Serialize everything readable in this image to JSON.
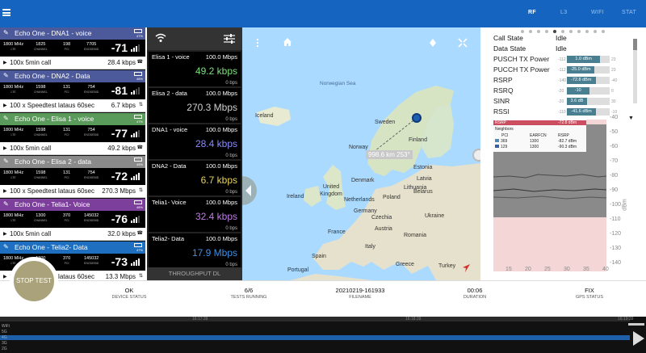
{
  "topbar": {
    "tabs": [
      {
        "label": "RF",
        "active": true
      },
      {
        "label": "L3",
        "active": false
      },
      {
        "label": "WIFI",
        "active": false
      },
      {
        "label": "STAT",
        "active": false
      }
    ]
  },
  "devices": [
    {
      "name": "Echo One - DNA1 - voice",
      "color": "#4c5a9c",
      "battery": "47%",
      "band": "1800 MHz",
      "tech": "LTE",
      "channel": "1825",
      "pci": "198",
      "enodeb": "7705",
      "signal": "-71",
      "task": "100x 5min call",
      "task_value": "28.4 kbps"
    },
    {
      "name": "Echo One - DNA2 - Data",
      "color": "#4c5a9c",
      "battery": "48%",
      "band": "1800 MHz",
      "tech": "LTE",
      "channel": "1598",
      "pci": "131",
      "enodeb": "754",
      "signal": "-81",
      "task": "100 x Speedtest lataus 60sec",
      "task_value": "6.7 kbps"
    },
    {
      "name": "Echo One - Elisa 1 - voice",
      "color": "#5a9a5a",
      "battery": "47%",
      "band": "1800 MHz",
      "tech": "LTE",
      "channel": "1598",
      "pci": "131",
      "enodeb": "754",
      "signal": "-77",
      "task": "100x 5min call",
      "task_value": "49.2 kbps"
    },
    {
      "name": "Echo One - Elisa 2 - data",
      "color": "#8a8a8a",
      "battery": "48%",
      "band": "1800 MHz",
      "tech": "LTE",
      "channel": "1598",
      "pci": "131",
      "enodeb": "754",
      "signal": "-72",
      "task": "100 x Speedtest lataus 60sec",
      "task_value": "270.3 Mbps"
    },
    {
      "name": "Echo One - Telia1- Voice",
      "color": "#7d3f9c",
      "battery": "48%",
      "band": "1800 MHz",
      "tech": "LTE",
      "channel": "1300",
      "pci": "370",
      "enodeb": "145032",
      "signal": "-76",
      "task": "100x 5min call",
      "task_value": "32.0 kbps"
    },
    {
      "name": "Echo One - Telia2- Data",
      "color": "#1f6fc0",
      "battery": "47%",
      "band": "1800 MHz",
      "tech": "LTE",
      "channel": "1300",
      "pci": "370",
      "enodeb": "145032",
      "signal": "-73",
      "task": "100 x Speedtest lataus 60sec",
      "task_value": "13.3 Mbps"
    }
  ],
  "throughput": {
    "footer": "THROUGHPUT DL",
    "rows": [
      {
        "name": "Elisa 1 - voice",
        "max": "100.0 Mbps",
        "rate": "49.2 kbps",
        "zero": "0 bps",
        "color": "#7be07b"
      },
      {
        "name": "Elisa 2 - data",
        "max": "100.0 Mbps",
        "rate": "270.3 Mbps",
        "zero": "0 bps",
        "color": "#cfcfcf"
      },
      {
        "name": "DNA1 - voice",
        "max": "100.0 Mbps",
        "rate": "28.4 kbps",
        "zero": "0 bps",
        "color": "#8a8aff"
      },
      {
        "name": "DNA2 - Data",
        "max": "100.0 Mbps",
        "rate": "6.7 kbps",
        "zero": "0 bps",
        "color": "#e6d25a"
      },
      {
        "name": "Telia1- Voice",
        "max": "100.0 Mbps",
        "rate": "32.4 kbps",
        "zero": "0 bps",
        "color": "#c07be6"
      },
      {
        "name": "Telia2- Data",
        "max": "100.0 Mbps",
        "rate": "17.9 Mbps",
        "zero": "0 bps",
        "color": "#3f8fe6"
      }
    ]
  },
  "map": {
    "distance": "998.6 km   253°",
    "labels": {
      "norwegian_sea": "Norwegian Sea",
      "iceland": "Iceland",
      "sweden": "Sweden",
      "finland": "Finland",
      "norway": "Norway",
      "estonia": "Estonia",
      "latvia": "Latvia",
      "denmark": "Denmark",
      "lithuania": "Lithuania",
      "united_kingdom": "United Kingdom",
      "belarus": "Belarus",
      "ireland": "Ireland",
      "netherlands": "Netherlands",
      "poland": "Poland",
      "germany": "Germany",
      "ukraine": "Ukraine",
      "czechia": "Czechia",
      "france": "France",
      "austria": "Austria",
      "romania": "Romania",
      "italy": "Italy",
      "spain": "Spain",
      "portugal": "Portugal",
      "greece": "Greece",
      "turkey": "Turkey"
    }
  },
  "rf": {
    "call_state_label": "Call State",
    "call_state": "Idle",
    "data_state_label": "Data State",
    "data_state": "Idle",
    "metrics": [
      {
        "label": "PUSCH TX Power",
        "lo": "-112",
        "value": "1.0 dBm",
        "hi": "23",
        "fill": 0.78
      },
      {
        "label": "PUCCH TX Power",
        "lo": "-112",
        "value": "-25.0 dBm",
        "hi": "23",
        "fill": 0.64
      },
      {
        "label": "RSRP",
        "lo": "-140",
        "value": "-72.8 dBm",
        "hi": "-40",
        "fill": 0.67
      },
      {
        "label": "RSRQ",
        "lo": "-20",
        "value": "-10",
        "hi": "0",
        "fill": 0.52
      },
      {
        "label": "SINR",
        "lo": "-20",
        "value": "3.6 dB",
        "hi": "30",
        "fill": 0.47
      },
      {
        "label": "RSSI",
        "lo": "-110",
        "value": "-41.6 dBm",
        "hi": "-10",
        "fill": 0.68
      }
    ],
    "chart": {
      "legend_label": "RSRP",
      "legend_value": "-72.8 dBm",
      "neighbors_title": "Neighbors",
      "neighbor_headers": [
        "PCI",
        "EARFCN",
        "RSRP"
      ],
      "neighbors": [
        {
          "pci": "369",
          "earfcn": "1300",
          "rsrp": "-82.7 dBm",
          "color": "#4a8ab8"
        },
        {
          "pci": "129",
          "earfcn": "1300",
          "rsrp": "-90.3 dBm",
          "color": "#2d5fa0"
        }
      ],
      "y_ticks": [
        "-40",
        "-50",
        "-60",
        "-70",
        "-80",
        "-90",
        "-100",
        "-110",
        "-120",
        "-130",
        "-140"
      ],
      "x_ticks": [
        "15",
        "20",
        "25",
        "30",
        "35",
        "40"
      ],
      "y_unit": "dBm"
    }
  },
  "status": {
    "stop_label": "STOP TEST",
    "cells": [
      {
        "value": "OK",
        "label": "DEVICE STATUS"
      },
      {
        "value": "6/6",
        "label": "TESTS RUNNING"
      },
      {
        "value": "20210219-161933",
        "label": "FILENAME"
      },
      {
        "value": "00:06",
        "label": "DURATION"
      },
      {
        "value": "FIX",
        "label": "GPS STATUS"
      }
    ]
  },
  "timeline": {
    "ticks": [
      "16:17:39",
      "16:18:39",
      "16:19:39"
    ],
    "rows": [
      "WiFi",
      "5G",
      "4G",
      "3G",
      "2G"
    ]
  }
}
